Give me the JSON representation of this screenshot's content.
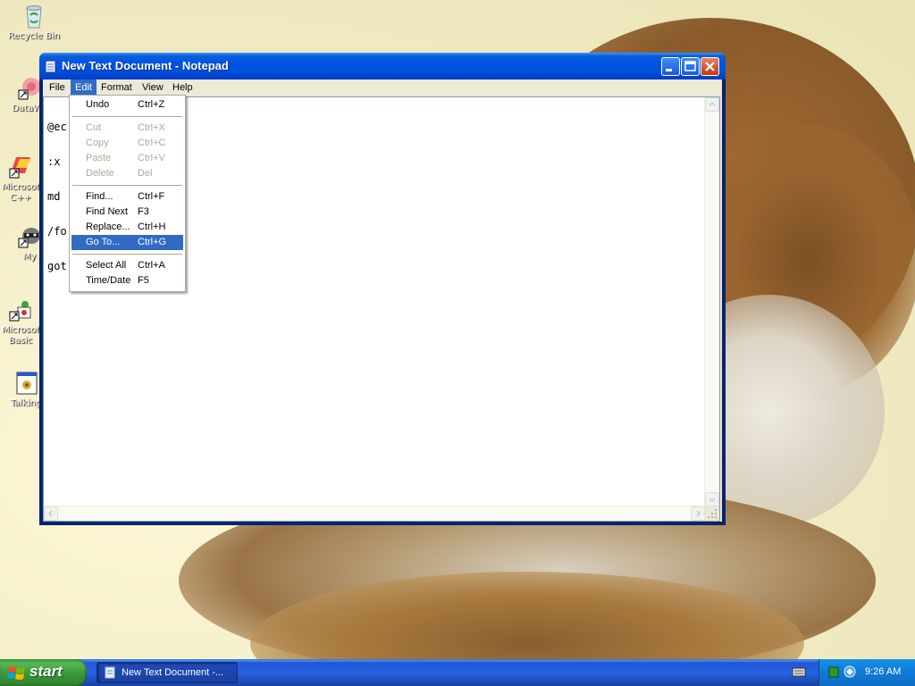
{
  "desktop": {
    "icons": [
      {
        "label": "Recycle Bin",
        "icon": "recycle-bin-icon"
      },
      {
        "label": "DataWa",
        "icon": "dreamweaver-shortcut-icon"
      },
      {
        "label": "Microsof",
        "label2": "C++",
        "icon": "visual-cpp-shortcut-icon"
      },
      {
        "label": "My",
        "icon": "raccoon-shortcut-icon"
      },
      {
        "label": "Microsof",
        "label2": "Basic",
        "icon": "visual-basic-shortcut-icon"
      },
      {
        "label": "Talking",
        "icon": "talking-app-icon"
      }
    ]
  },
  "window": {
    "title": "New Text Document - Notepad",
    "menus": [
      "File",
      "Edit",
      "Format",
      "View",
      "Help"
    ],
    "open_menu": "Edit",
    "text_lines": [
      "@ec",
      ":x",
      "md :",
      "/fo",
      "got"
    ]
  },
  "edit_menu": {
    "items": [
      {
        "label": "Undo",
        "shortcut": "Ctrl+Z",
        "enabled": true
      },
      {
        "label": "Cut",
        "shortcut": "Ctrl+X",
        "enabled": false
      },
      {
        "label": "Copy",
        "shortcut": "Ctrl+C",
        "enabled": false
      },
      {
        "label": "Paste",
        "shortcut": "Ctrl+V",
        "enabled": false
      },
      {
        "label": "Delete",
        "shortcut": "Del",
        "enabled": false
      },
      {
        "label": "Find...",
        "shortcut": "Ctrl+F",
        "enabled": true
      },
      {
        "label": "Find Next",
        "shortcut": "F3",
        "enabled": true
      },
      {
        "label": "Replace...",
        "shortcut": "Ctrl+H",
        "enabled": true
      },
      {
        "label": "Go To...",
        "shortcut": "Ctrl+G",
        "enabled": true,
        "highlighted": true
      },
      {
        "label": "Select All",
        "shortcut": "Ctrl+A",
        "enabled": true
      },
      {
        "label": "Time/Date",
        "shortcut": "F5",
        "enabled": true
      }
    ]
  },
  "taskbar": {
    "start_label": "start",
    "task_label": "New Text Document -...",
    "clock": "9:26 AM"
  },
  "colors": {
    "title_blue": "#0054e3",
    "menu_highlight": "#316ac5",
    "start_green": "#3a9b3a",
    "tray_blue": "#0f7ad6"
  }
}
